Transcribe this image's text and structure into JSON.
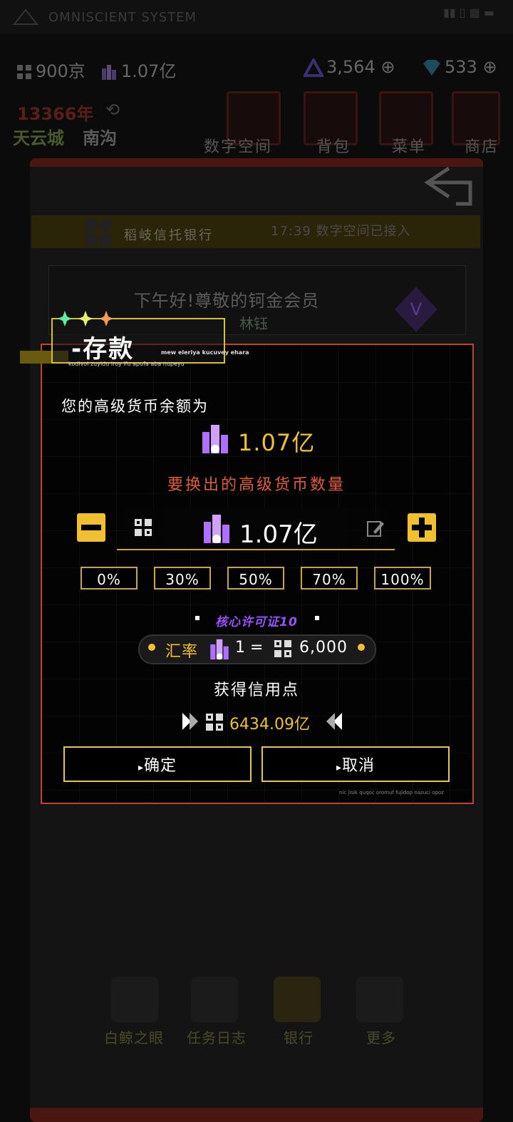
{
  "status_bar": {
    "app_title": "OMNISCIENT SYSTEM"
  },
  "resources": {
    "currency_low": "900京",
    "currency_high": "1.07亿",
    "gems": "3,564",
    "diamonds": "533"
  },
  "location": {
    "year": "13366年",
    "city": "天云城",
    "district": "南沟"
  },
  "top_nav": [
    {
      "label": "数字空间",
      "icon": "digital-space-icon"
    },
    {
      "label": "背包",
      "icon": "backpack-icon"
    },
    {
      "label": "菜单",
      "icon": "menu-icon"
    },
    {
      "label": "商店",
      "icon": "shop-cart-icon"
    }
  ],
  "bank": {
    "name": "稻岐信托银行",
    "time_status": "17:39 数字空间已接入",
    "greeting": "下午好!尊敬的钶金会员",
    "member_name": "林钰"
  },
  "bottom_nav": [
    {
      "label": "白鲸之眼"
    },
    {
      "label": "任务日志"
    },
    {
      "label": "银行"
    },
    {
      "label": "更多"
    }
  ],
  "dialog": {
    "title": "-存款",
    "title_sub": "mew eleriya kucuvey ehara",
    "title_sub2": "kodivol zuyidu iroy ifu apufa aba nupeyu",
    "balance_label": "您的高级货币余额为",
    "balance_value": "1.07亿",
    "exchange_label": "要换出的高级货币数量",
    "amount_value": "1.07亿",
    "percent_options": [
      "0%",
      "30%",
      "50%",
      "70%",
      "100%"
    ],
    "license": "核心许可证10",
    "rate_label": "汇率",
    "rate_left": "1 =",
    "rate_right": "6,000",
    "credit_label": "获得信用点",
    "credit_value": "6434.09亿",
    "confirm_label": "确定",
    "cancel_label": "取消",
    "footer_text": "nic jisik quqoc oromuf fujidop nazuci opoz"
  },
  "colors": {
    "accent_yellow": "#f0c030",
    "modal_border": "#c0402e",
    "exchange_red": "#e05a3a",
    "license_purple": "#9a50ff",
    "crystal_purple": "#b070ff"
  }
}
